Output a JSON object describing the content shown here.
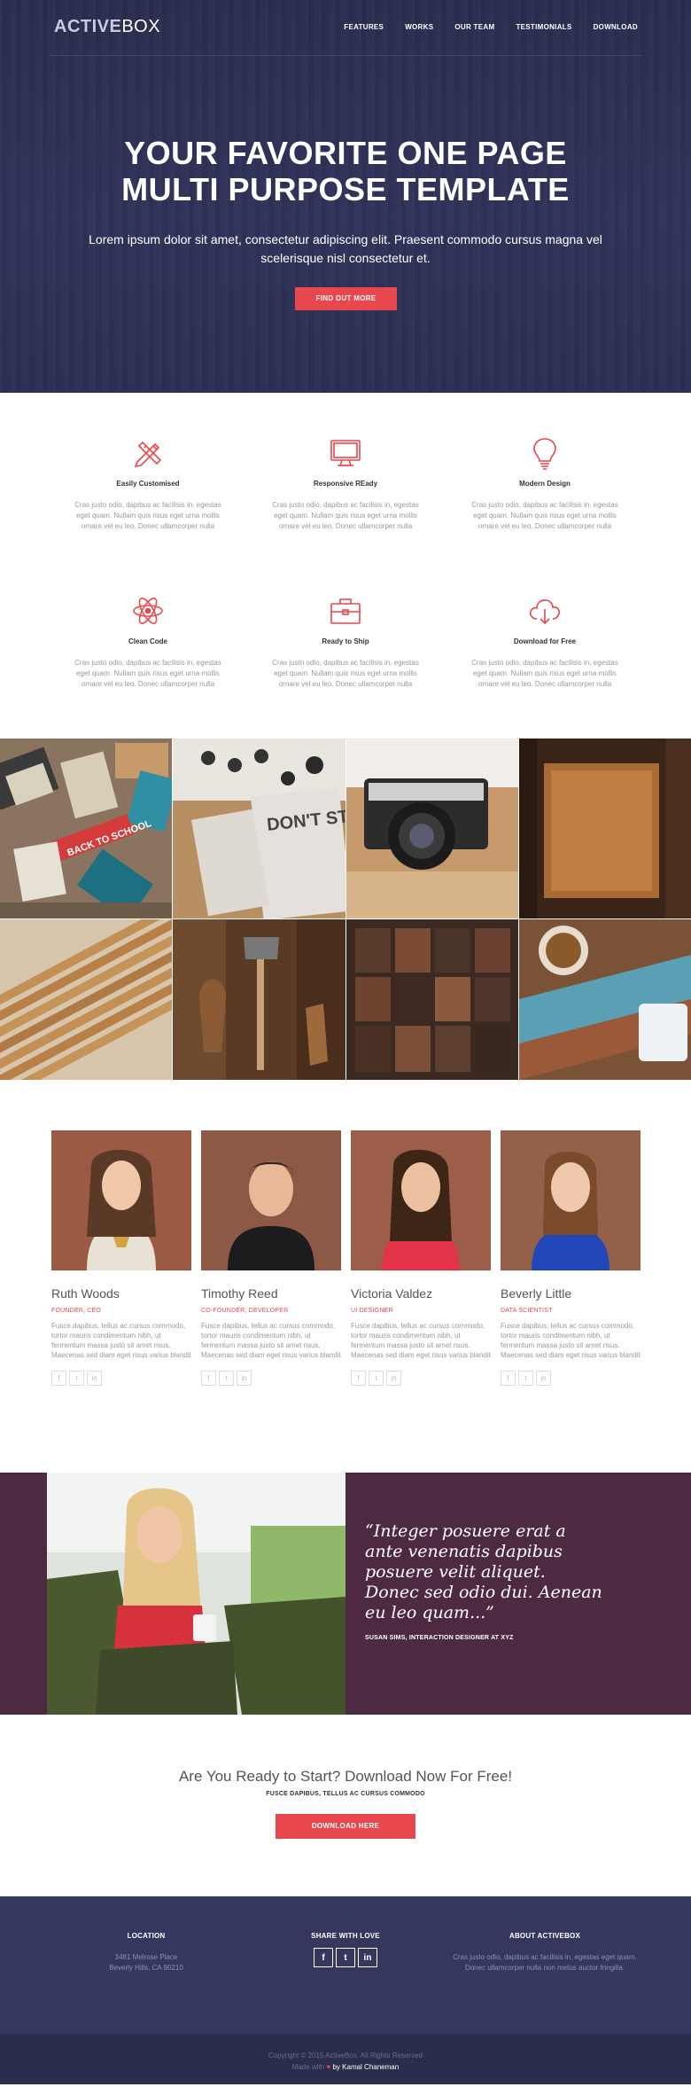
{
  "brand": {
    "logo_bold": "ACTIVE",
    "logo_light": "BOX"
  },
  "nav": {
    "links": [
      "FEATURES",
      "WORKS",
      "OUR TEAM",
      "TESTIMONIALS",
      "DOWNLOAD"
    ]
  },
  "hero": {
    "title_line1": "YOUR FAVORITE ONE PAGE",
    "title_line2": "MULTI PURPOSE TEMPLATE",
    "text": "Lorem ipsum dolor sit amet, consectetur adipiscing elit. Praesent commodo cursus magna vel scelerisque nisl consectetur et.",
    "button": "FIND OUT MORE"
  },
  "features": [
    {
      "icon": "pencil-ruler-icon",
      "title": "Easily Customised",
      "text": "Cras justo odio, dapibus ac facilisis in, egestas eget quam. Nullam quis risus eget urna mollis ornare vel eu leo. Donec ullamcorper nulla"
    },
    {
      "icon": "monitor-icon",
      "title": "Responsive REady",
      "text": "Cras justo odio, dapibus ac facilisis in, egestas eget quam. Nullam quis risus eget urna mollis ornare vel eu leo. Donec ullamcorper nulla"
    },
    {
      "icon": "lightbulb-icon",
      "title": "Modern Design",
      "text": "Cras justo odio, dapibus ac facilisis in, egestas eget quam. Nullam quis risus eget urna mollis ornare vel eu leo. Donec ullamcorper nulla"
    },
    {
      "icon": "atom-icon",
      "title": "Clean Code",
      "text": "Cras justo odio, dapibus ac facilisis in, egestas eget quam. Nullam quis risus eget urna mollis ornare vel eu leo. Donec ullamcorper nulla"
    },
    {
      "icon": "briefcase-icon",
      "title": "Ready to Ship",
      "text": "Cras justo odio, dapibus ac facilisis in, egestas eget quam. Nullam quis risus eget urna mollis ornare vel eu leo. Donec ullamcorper nulla"
    },
    {
      "icon": "cloud-download-icon",
      "title": "Download for Free",
      "text": "Cras justo odio, dapibus ac facilisis in, egestas eget quam. Nullam quis risus eget urna mollis ornare vel eu leo. Donec ullamcorper nulla"
    }
  ],
  "gallery": {
    "tiles": [
      {
        "name": "stationery-tile",
        "text": "BACK TO SCHOOL"
      },
      {
        "name": "typewriter-print-tile",
        "text": "DON'T STAND THERE"
      },
      {
        "name": "camera-tile"
      },
      {
        "name": "leather-notebook-tile"
      },
      {
        "name": "pencils-tile"
      },
      {
        "name": "tools-tile"
      },
      {
        "name": "letterpress-tile"
      },
      {
        "name": "coffee-table-tile"
      }
    ]
  },
  "team": [
    {
      "name": "Ruth Woods",
      "role": "FOUNDER, CEO",
      "bio": "Fusce dapibus, tellus ac cursus commodo, tortor mauris condimentum nibh, ut fermentum massa justo sit amet risus. Maecenas sed diam eget risus varius blandit sit amet non magna. Nullam id dolor id nibh ultricies vehicula ut id elit.",
      "social": [
        "f",
        "t",
        "in"
      ]
    },
    {
      "name": "Timothy Reed",
      "role": "CO-FOUNDER, DEVELOPER",
      "bio": "Fusce dapibus, tellus ac cursus commodo, tortor mauris condimentum nibh, ut fermentum massa justo sit amet risus. Maecenas sed diam eget risus varius blandit sit amet non magna. Nullam id dolor id nibh ultricies vehicula ut id elit.",
      "social": [
        "f",
        "t",
        "in"
      ]
    },
    {
      "name": "Victoria Valdez",
      "role": "UI DESIGNER",
      "bio": "Fusce dapibus, tellus ac cursus commodo, tortor mauris condimentum nibh, ut fermentum massa justo sit amet risus. Maecenas sed diam eget risus varius blandit sit amet non magna. Nullam id dolor id nibh ultricies vehicula ut id elit.",
      "social": [
        "f",
        "t",
        "in"
      ]
    },
    {
      "name": "Beverly Little",
      "role": "DATA SCIENTIST",
      "bio": "Fusce dapibus, tellus ac cursus commodo, tortor mauris condimentum nibh, ut fermentum massa justo sit amet risus. Maecenas sed diam eget risus varius blandit sit amet non magna. Nullam id dolor id nibh ultricies vehicula ut id elit.",
      "social": [
        "f",
        "t",
        "in"
      ]
    }
  ],
  "testimonial": {
    "quote": "“Integer posuere erat a ante venenatis dapibus posuere velit aliquet. Donec sed odio dui. Aenean eu leo quam...”",
    "author": "SUSAN SIMS, INTERACTION DESIGNER AT XYZ"
  },
  "cta": {
    "title": "Are You Ready to Start? Download Now For Free!",
    "subtitle": "FUSCE DAPIBUS, TELLUS AC CURSUS COMMODO",
    "button": "DOWNLOAD HERE"
  },
  "footer": {
    "location": {
      "title": "LOCATION",
      "line1": "3481 Melrose Place",
      "line2": "Beverly Hills, CA 90210"
    },
    "share": {
      "title": "SHARE WITH LOVE",
      "icons": [
        "f",
        "t",
        "in"
      ]
    },
    "about": {
      "title": "ABOUT ACTIVEBOX",
      "text": "Cras justo odio, dapibus ac facilisis in, egestas eget quam. Donec ullamcorper nulla non metus auctor fringilla."
    },
    "copyright": "Copyright © 2015 ActiveBox. All Rights Reserved",
    "made_with": "Made with",
    "heart": "♥",
    "author": "by Kamal Chaneman"
  },
  "colors": {
    "accent": "#e8474d",
    "hero_bg": "#2f3257",
    "testimonial_bg": "#4e2a42",
    "footer_bg": "#35375e"
  }
}
